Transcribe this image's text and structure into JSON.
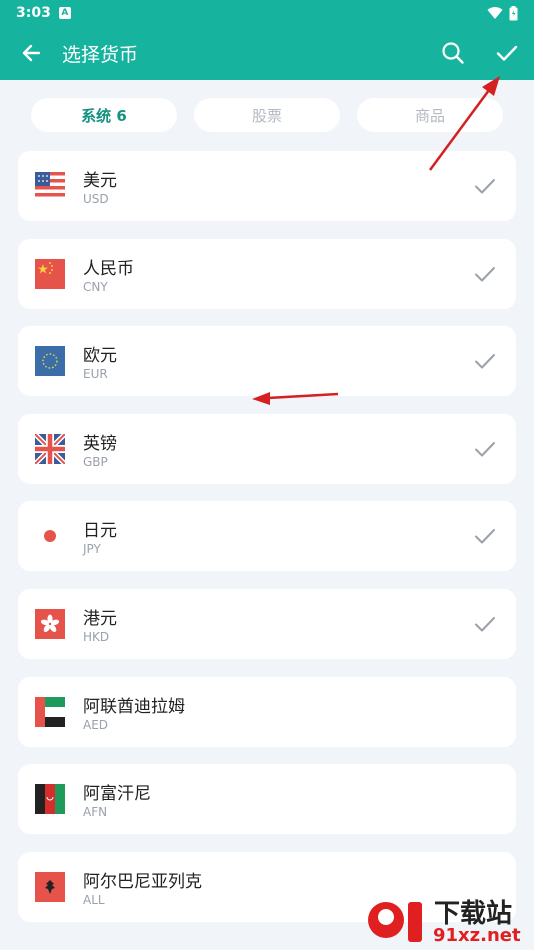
{
  "status_bar": {
    "time": "3:03",
    "badge": "A"
  },
  "toolbar": {
    "title": "选择货币"
  },
  "tabs": [
    {
      "label": "系统 6",
      "active": true
    },
    {
      "label": "股票",
      "active": false
    },
    {
      "label": "商品",
      "active": false
    }
  ],
  "currencies": [
    {
      "name": "美元",
      "code": "USD",
      "checked": true,
      "flag": "us-flag-icon"
    },
    {
      "name": "人民币",
      "code": "CNY",
      "checked": true,
      "flag": "cn-flag-icon"
    },
    {
      "name": "欧元",
      "code": "EUR",
      "checked": true,
      "flag": "eu-flag-icon"
    },
    {
      "name": "英镑",
      "code": "GBP",
      "checked": true,
      "flag": "gb-flag-icon"
    },
    {
      "name": "日元",
      "code": "JPY",
      "checked": true,
      "flag": "jp-flag-icon"
    },
    {
      "name": "港元",
      "code": "HKD",
      "checked": true,
      "flag": "hk-flag-icon"
    },
    {
      "name": "阿联酋迪拉姆",
      "code": "AED",
      "checked": false,
      "flag": "ae-flag-icon"
    },
    {
      "name": "阿富汗尼",
      "code": "AFN",
      "checked": false,
      "flag": "af-flag-icon"
    },
    {
      "name": "阿尔巴尼亚列克",
      "code": "ALL",
      "checked": false,
      "flag": "al-flag-icon"
    }
  ],
  "watermark": {
    "line1": "下载站",
    "line2": "91xz.net"
  },
  "colors": {
    "accent": "#16b39f",
    "active_tab": "#13917f",
    "annotation_arrow": "#d42020"
  }
}
